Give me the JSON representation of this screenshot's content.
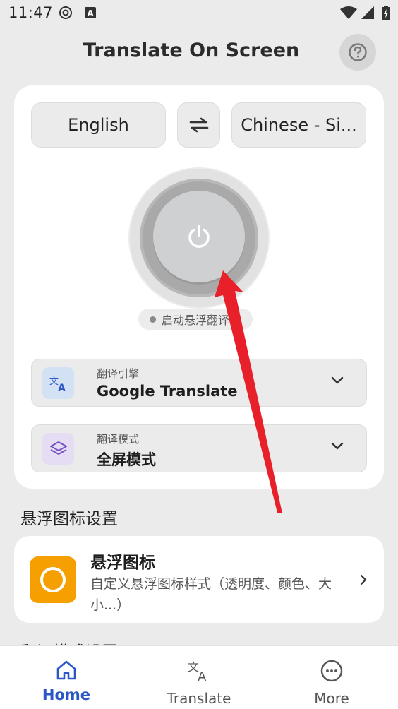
{
  "status_bar": {
    "time": "11:47",
    "icons_left": [
      "at-sign-icon",
      "font-a-icon"
    ],
    "icons_right": [
      "wifi-icon",
      "signal-icon",
      "battery-icon"
    ]
  },
  "header": {
    "title": "Translate On Screen",
    "help_icon": "question-circle-icon"
  },
  "languages": {
    "source": "English",
    "target": "Chinese - Si...",
    "swap_icon": "swap-arrows-icon"
  },
  "power": {
    "icon": "power-icon",
    "status_text": "启动悬浮翻译"
  },
  "engine": {
    "caption": "翻译引擎",
    "value": "Google Translate",
    "icon": "translate-icon"
  },
  "mode": {
    "caption": "翻译模式",
    "value": "全屏模式",
    "icon": "layers-icon"
  },
  "float_section": {
    "heading": "悬浮图标设置",
    "item_title": "悬浮图标",
    "item_desc": "自定义悬浮图标样式（透明度、颜色、大小...）"
  },
  "next_section": {
    "heading": "翻译模式设置"
  },
  "bottom_nav": {
    "items": [
      {
        "label": "Home",
        "icon": "home-icon",
        "active": true
      },
      {
        "label": "Translate",
        "icon": "translate-icon",
        "active": false
      },
      {
        "label": "More",
        "icon": "more-circle-icon",
        "active": false
      }
    ]
  },
  "colors": {
    "accent": "#2a56c6",
    "float_icon_bg": "#f5a000",
    "annotation": "#e8202a"
  }
}
